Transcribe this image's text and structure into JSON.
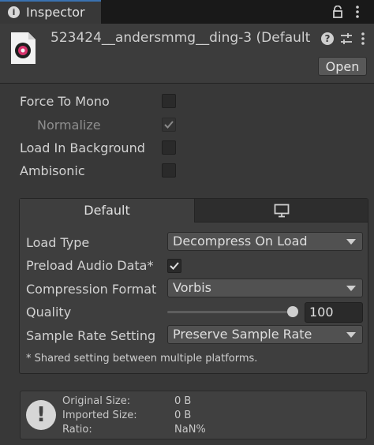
{
  "tab": {
    "title": "Inspector",
    "info_icon": "info-icon",
    "lock_icon": "lock-icon",
    "menu_icon": "kebab-menu-icon"
  },
  "header": {
    "asset_name": "523424__andersmmg__ding-3 (Default",
    "help_icon": "help-icon",
    "presets_icon": "presets-sliders-icon",
    "more_icon": "more-vertical-icon",
    "open_label": "Open"
  },
  "properties": {
    "force_to_mono": {
      "label": "Force To Mono",
      "checked": false
    },
    "normalize": {
      "label": "Normalize",
      "checked": true,
      "disabled": true
    },
    "load_in_background": {
      "label": "Load In Background",
      "checked": false
    },
    "ambisonic": {
      "label": "Ambisonic",
      "checked": false
    }
  },
  "platform_tabs": {
    "default_label": "Default",
    "standalone_icon": "monitor-icon",
    "active": "Default"
  },
  "settings": {
    "load_type": {
      "label": "Load Type",
      "value": "Decompress On Load"
    },
    "preload_audio_data": {
      "label": "Preload Audio Data*",
      "checked": true
    },
    "compression_format": {
      "label": "Compression Format",
      "value": "Vorbis"
    },
    "quality": {
      "label": "Quality",
      "value": "100",
      "slider_fraction": 1.0
    },
    "sample_rate_setting": {
      "label": "Sample Rate Setting",
      "value": "Preserve Sample Rate"
    },
    "note": "* Shared setting between multiple platforms."
  },
  "info": {
    "icon": "warning-exclamation-icon",
    "original_size_label": "Original Size:",
    "original_size_value": "0 B",
    "imported_size_label": "Imported Size:",
    "imported_size_value": "0 B",
    "ratio_label": "Ratio:",
    "ratio_value": "NaN%"
  },
  "colors": {
    "background": "#383838",
    "tab_accent": "#3a72b0",
    "text": "#d2d2d2"
  }
}
